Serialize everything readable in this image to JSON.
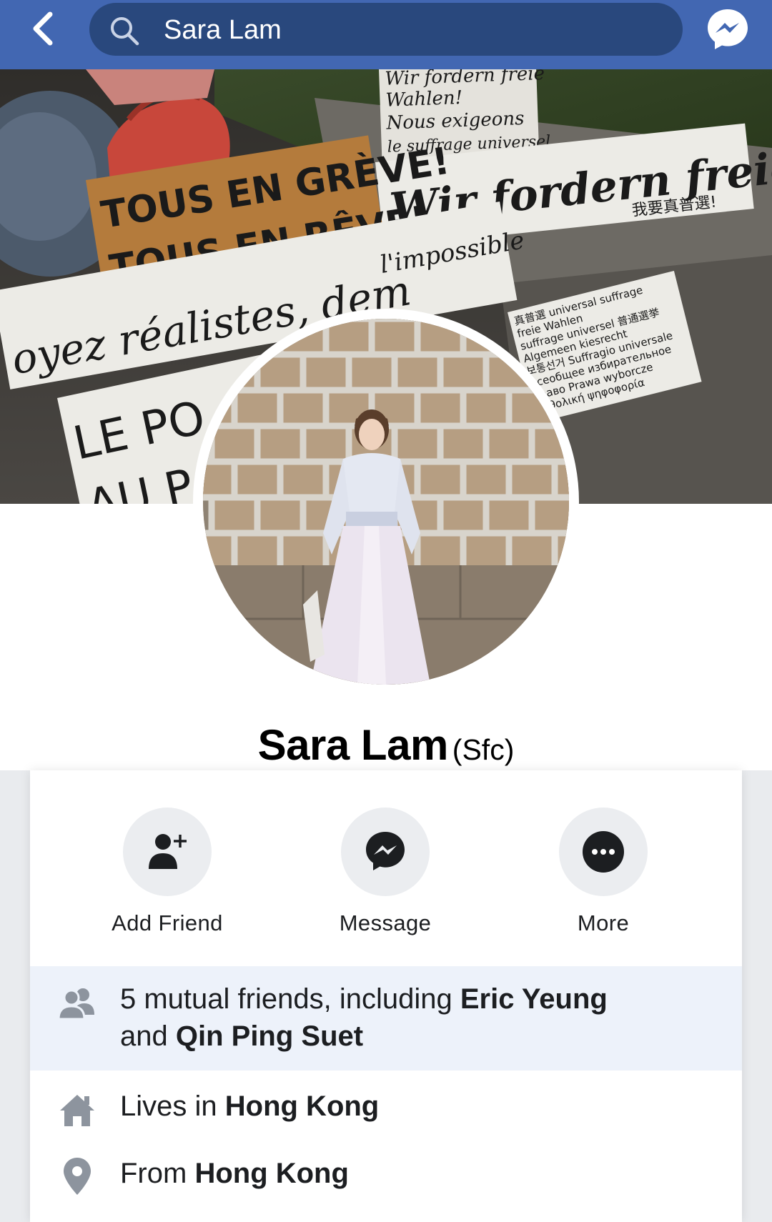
{
  "search": {
    "query": "Sara Lam"
  },
  "profile": {
    "name": "Sara Lam",
    "alternate_name": "(Sfc)"
  },
  "actions": [
    {
      "label": "Add Friend",
      "icon": "add-friend-icon"
    },
    {
      "label": "Message",
      "icon": "messenger-icon"
    },
    {
      "label": "More",
      "icon": "more-icon"
    }
  ],
  "info": {
    "mutual_prefix": "5 mutual friends, including ",
    "mutual_friend_1": "Eric Yeung",
    "mutual_joiner": "and ",
    "mutual_friend_2": "Qin Ping Suet",
    "lives_prefix": "Lives in ",
    "lives_place": "Hong Kong",
    "from_prefix": "From ",
    "from_place": "Hong Kong"
  },
  "cover_signs": {
    "sign1_line1": "TOUS EN GRÈVE!",
    "sign1_line2": "TOUS EN RÊVE!",
    "sign2": "Wir fordern freie Wahlen!",
    "sign2_chinese": "我要真普選!",
    "sign3_line1": "Wir fordern freie",
    "sign3_line2": "Wahlen!",
    "sign3_line3": "Nous exigeons",
    "sign3_line4": "le suffrage universel",
    "sign4": "oyez réalistes, dem",
    "sign4_end": "l'impossible",
    "sign5_line1": "LE PO",
    "sign5_line2": "AU P",
    "sign6_line1": "真普選 universal suffrage",
    "sign6_line2": "freie Wahlen",
    "sign6_line3": "suffrage universel 普通選挙",
    "sign6_line4": "Algemeen kiesrecht",
    "sign6_line5": "보통선거 Suffragio universale",
    "sign6_line6": "Всеобщее избирательное",
    "sign6_line7": "право Prawa wyborcze",
    "sign6_line8": "καθολική ψηφοφορία"
  },
  "colors": {
    "brand_blue": "#4267b2",
    "search_bg": "#29487d",
    "mutual_bg": "#edf2fa",
    "icon_gray": "#8d949e"
  }
}
